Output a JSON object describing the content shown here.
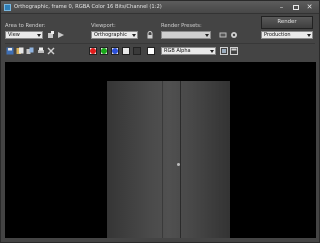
{
  "window": {
    "title": "Orthographic, frame 0, RGBA Color 16 Bits/Channel (1:2)",
    "controls": {
      "minimize": "–",
      "close": "✕"
    }
  },
  "area": {
    "label": "Area to Render:",
    "value": "View"
  },
  "viewport": {
    "label": "Viewport:",
    "value": "Orthographic"
  },
  "presets": {
    "label": "Render Presets:",
    "value": ""
  },
  "render": {
    "label": "Render",
    "mode": "Production"
  },
  "toolbar": {
    "channel_display": "RGB Alpha",
    "channel_colors": {
      "red": "#e21b1b",
      "green": "#18a818",
      "blue": "#2b4fd8"
    }
  },
  "colors": {
    "window_bg": "#444444",
    "viewport_bg": "#000000",
    "accent": "#2e7fb8"
  }
}
